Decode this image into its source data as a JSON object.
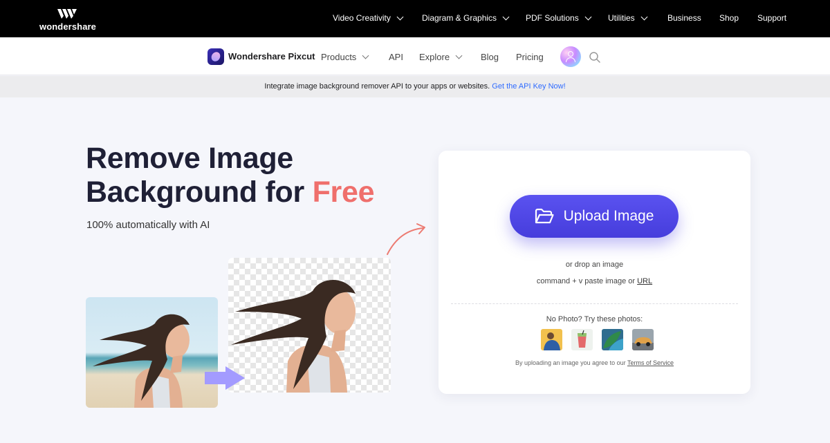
{
  "topbar": {
    "brand": "wondershare",
    "nav": [
      {
        "label": "Video Creativity",
        "has_dropdown": true
      },
      {
        "label": "Diagram & Graphics",
        "has_dropdown": true
      },
      {
        "label": "PDF Solutions",
        "has_dropdown": true
      },
      {
        "label": "Utilities",
        "has_dropdown": true
      },
      {
        "label": "Business",
        "has_dropdown": false
      },
      {
        "label": "Shop",
        "has_dropdown": false
      },
      {
        "label": "Support",
        "has_dropdown": false
      }
    ]
  },
  "subnav": {
    "product_name": "Wondershare Pixcut",
    "items": [
      {
        "label": "Products",
        "has_dropdown": true
      },
      {
        "label": "API",
        "has_dropdown": false
      },
      {
        "label": "Explore",
        "has_dropdown": true
      },
      {
        "label": "Blog",
        "has_dropdown": false
      },
      {
        "label": "Pricing",
        "has_dropdown": false
      }
    ],
    "icons": [
      "avatar-icon",
      "search-icon"
    ]
  },
  "announcement": {
    "text": "Integrate image background remover API to your apps or websites.",
    "link": "Get the API Key Now!"
  },
  "hero": {
    "title_line1": "Remove Image",
    "title_line2_prefix": "Background for",
    "title_highlight": "Free",
    "subtitle": "100% automatically with AI",
    "highlight_color": "#ef6f6c"
  },
  "upload_card": {
    "button_label": "Upload Image",
    "button_color": "#4f46e5",
    "drop_text": "or drop an image",
    "paste_text": "command + v paste image or",
    "paste_link": "URL",
    "try_text": "No Photo? Try these photos:",
    "sample_photos": [
      "sample-photo-man",
      "sample-photo-drink",
      "sample-photo-leaves",
      "sample-photo-car"
    ],
    "tos_text": "By uploading an image you agree to our",
    "tos_link": "Terms of Service"
  }
}
